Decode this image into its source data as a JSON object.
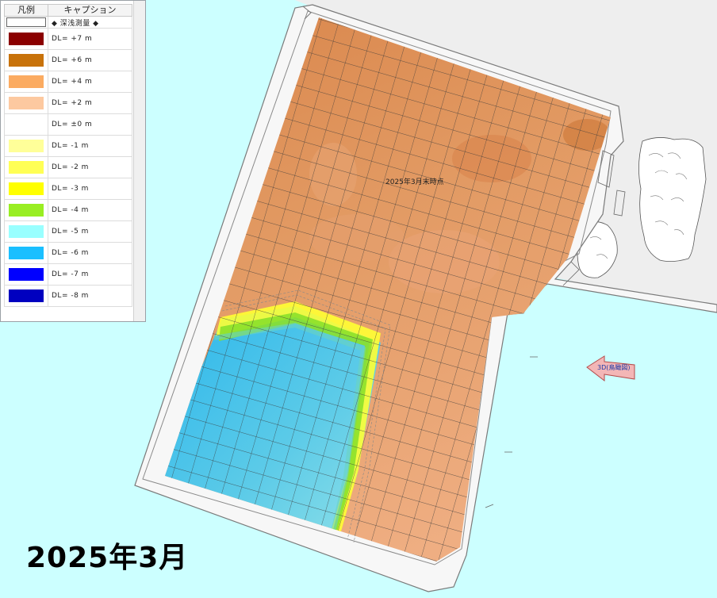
{
  "legend": {
    "header": {
      "col1": "凡例",
      "col2": "キャプション"
    },
    "section_label": "◆ 深浅測量 ◆",
    "items": [
      {
        "label": "DL= +7 m",
        "color": "#8b0000"
      },
      {
        "label": "DL= +6 m",
        "color": "#c8720a"
      },
      {
        "label": "DL= +4 m",
        "color": "#fbab61"
      },
      {
        "label": "DL= +2 m",
        "color": "#fdc9a0"
      },
      {
        "label": "DL= ±0 m",
        "color": "#ffffff"
      },
      {
        "label": "DL= -1 m",
        "color": "#ffff99"
      },
      {
        "label": "DL= -2 m",
        "color": "#ffff55"
      },
      {
        "label": "DL= -3 m",
        "color": "#ffff00"
      },
      {
        "label": "DL= -4 m",
        "color": "#99ee22"
      },
      {
        "label": "DL= -5 m",
        "color": "#99ffff"
      },
      {
        "label": "DL= -6 m",
        "color": "#1abfff"
      },
      {
        "label": "DL= -7 m",
        "color": "#0000ff"
      },
      {
        "label": "DL= -8 m",
        "color": "#0000c0"
      }
    ]
  },
  "map": {
    "title": "2025年3月",
    "survey_label": "2025年3月末時点",
    "arrow_label": "3D(鳥瞰図)",
    "colors": {
      "sea": "#ccffff",
      "land": "#eeeeee",
      "orange_dark": "#d9884a",
      "orange_light": "#eea978",
      "water": "#4fc8ea"
    }
  }
}
